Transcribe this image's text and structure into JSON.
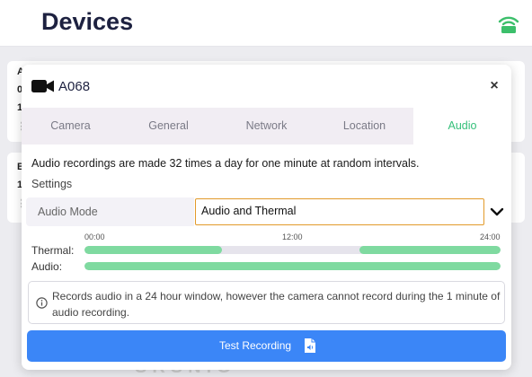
{
  "page": {
    "title": "Devices"
  },
  "background": {
    "card1_frags": [
      "A",
      "0",
      "1",
      "⋮"
    ],
    "card2_frags": [
      "B",
      "1",
      "⋮"
    ],
    "watermark": "SRSNIG"
  },
  "modal": {
    "device_name": "A068",
    "close_label": "×",
    "tabs": [
      {
        "label": "Camera"
      },
      {
        "label": "General"
      },
      {
        "label": "Network"
      },
      {
        "label": "Location"
      },
      {
        "label": "Audio"
      }
    ],
    "active_tab": "Audio",
    "description": "Audio recordings are made 32 times a day for one minute at random intervals.",
    "settings_label": "Settings",
    "audio_mode": {
      "label": "Audio Mode",
      "value": "Audio and Thermal"
    },
    "timeline": {
      "ticks": [
        "00:00",
        "12:00",
        "24:00"
      ],
      "rows": [
        {
          "label": "Thermal:",
          "segments": [
            [
              0.0,
              0.33
            ],
            [
              0.66,
              1.0
            ]
          ]
        },
        {
          "label": "Audio:",
          "segments": [
            [
              0.0,
              1.0
            ]
          ]
        }
      ]
    },
    "info_text": "Records audio in a 24 hour window, however the camera cannot record during the 1 minute of audio recording.",
    "test_button": "Test Recording"
  },
  "colors": {
    "accent_green": "#35c07a",
    "bar_green": "#7fdaa0",
    "primary_blue": "#3b86f7",
    "select_border": "#e29a2a"
  },
  "icons": [
    "signal-icon",
    "camera-icon",
    "close-icon",
    "chevron-down-icon",
    "info-icon",
    "audio-file-icon"
  ]
}
